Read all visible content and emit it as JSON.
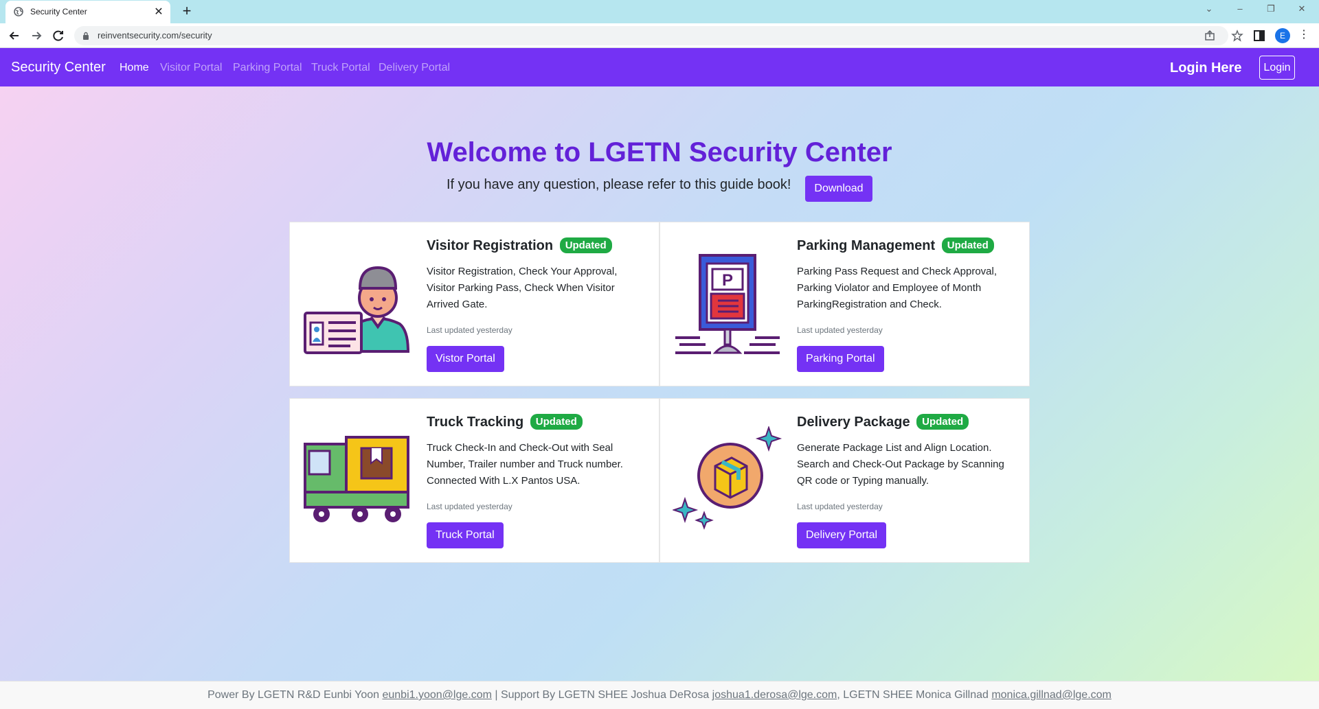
{
  "browser": {
    "tab_title": "Security Center",
    "tab_close": "✕",
    "new_tab": "+",
    "url": "reinventsecurity.com/security",
    "profile_initial": "E"
  },
  "navbar": {
    "brand": "Security Center",
    "links": [
      "Home",
      "Visitor Portal",
      "Parking Portal",
      "Truck Portal",
      "Delivery Portal"
    ],
    "login_here": "Login Here",
    "login_button": "Login",
    "color": "#7432f4"
  },
  "hero": {
    "title": "Welcome to LGETN Security Center",
    "subtitle": "If you have any question, please refer to this guide book!",
    "download_button": "Download"
  },
  "cards": [
    {
      "title": "Visitor Registration",
      "badge": "Updated",
      "description": "Visitor Registration, Check Your Approval, Visitor Parking Pass, Check When Visitor Arrived Gate.",
      "updated": "Last updated yesterday",
      "button": "Vistor Portal",
      "icon": "visitor-id-icon"
    },
    {
      "title": "Parking Management",
      "badge": "Updated",
      "description": "Parking Pass Request and Check Approval, Parking Violator and Employee of Month ParkingRegistration and Check.",
      "updated": "Last updated yesterday",
      "button": "Parking Portal",
      "icon": "parking-sign-icon"
    },
    {
      "title": "Truck Tracking",
      "badge": "Updated",
      "description": "Truck Check-In and Check-Out with Seal Number, Trailer number and Truck number. Connected With L.X Pantos USA.",
      "updated": "Last updated yesterday",
      "button": "Truck Portal",
      "icon": "truck-icon"
    },
    {
      "title": "Delivery Package",
      "badge": "Updated",
      "description": "Generate Package List and Align Location. Search and Check-Out Package by Scanning QR code or Typing manually.",
      "updated": "Last updated yesterday",
      "button": "Delivery Portal",
      "icon": "package-icon"
    }
  ],
  "footer": {
    "prefix": "Power By LGETN R&D Eunbi Yoon ",
    "email1": "eunbi1.yoon@lge.com",
    "mid1": " | Support By LGETN SHEE Joshua DeRosa ",
    "email2": "joshua1.derosa@lge.com",
    "mid2": ", LGETN SHEE Monica Gillnad ",
    "email3": "monica.gillnad@lge.com"
  },
  "colors": {
    "primary": "#7432f4",
    "heading": "#6321d8",
    "badge": "#1faa44"
  }
}
